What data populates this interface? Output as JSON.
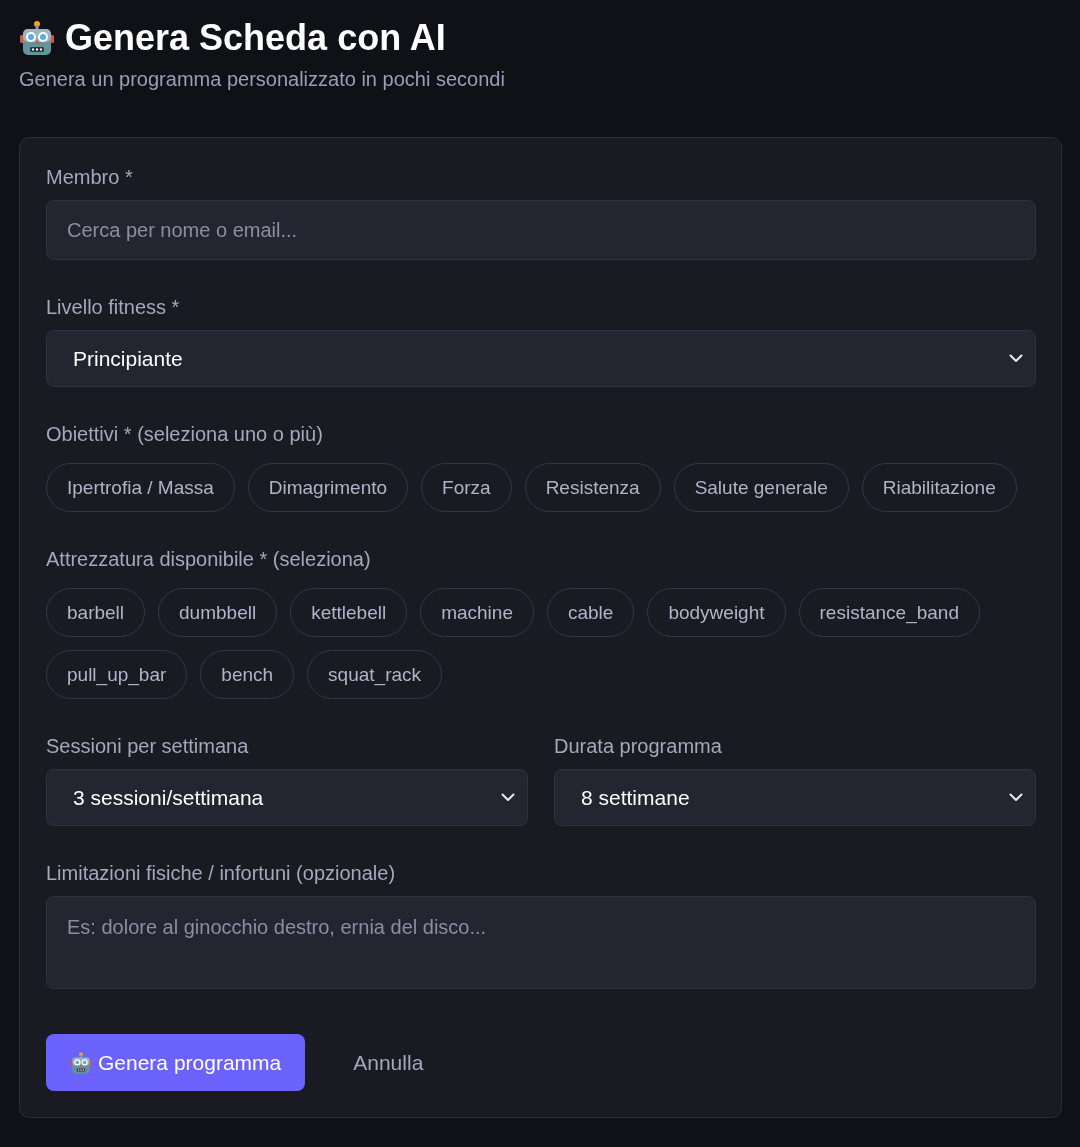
{
  "header": {
    "title": "Genera Scheda con AI",
    "subtitle": "Genera un programma personalizzato in pochi secondi"
  },
  "form": {
    "member": {
      "label": "Membro *",
      "placeholder": "Cerca per nome o email..."
    },
    "fitness_level": {
      "label": "Livello fitness *",
      "value": "Principiante"
    },
    "goals": {
      "label": "Obiettivi * (seleziona uno o più)",
      "options": [
        {
          "label": "Ipertrofia / Massa",
          "selected": false
        },
        {
          "label": "Dimagrimento",
          "selected": false
        },
        {
          "label": "Forza",
          "selected": false
        },
        {
          "label": "Resistenza",
          "selected": false
        },
        {
          "label": "Salute generale",
          "selected": false
        },
        {
          "label": "Riabilitazione",
          "selected": false
        }
      ]
    },
    "equipment": {
      "label": "Attrezzatura disponibile * (seleziona)",
      "options": [
        {
          "label": "barbell",
          "selected": false
        },
        {
          "label": "dumbbell",
          "selected": false
        },
        {
          "label": "kettlebell",
          "selected": false
        },
        {
          "label": "machine",
          "selected": false
        },
        {
          "label": "cable",
          "selected": false
        },
        {
          "label": "bodyweight",
          "selected": false
        },
        {
          "label": "resistance_band",
          "selected": false
        },
        {
          "label": "pull_up_bar",
          "selected": false
        },
        {
          "label": "bench",
          "selected": false
        },
        {
          "label": "squat_rack",
          "selected": false
        }
      ]
    },
    "sessions": {
      "label": "Sessioni per settimana",
      "value": "3 sessioni/settimana"
    },
    "duration": {
      "label": "Durata programma",
      "value": "8 settimane"
    },
    "limitations": {
      "label": "Limitazioni fisiche / infortuni (opzionale)",
      "placeholder": "Es: dolore al ginocchio destro, ernia del disco..."
    },
    "buttons": [
      {
        "label": "Genera programma",
        "kind": "primary"
      },
      {
        "label": "Annulla",
        "kind": "secondary"
      }
    ]
  }
}
